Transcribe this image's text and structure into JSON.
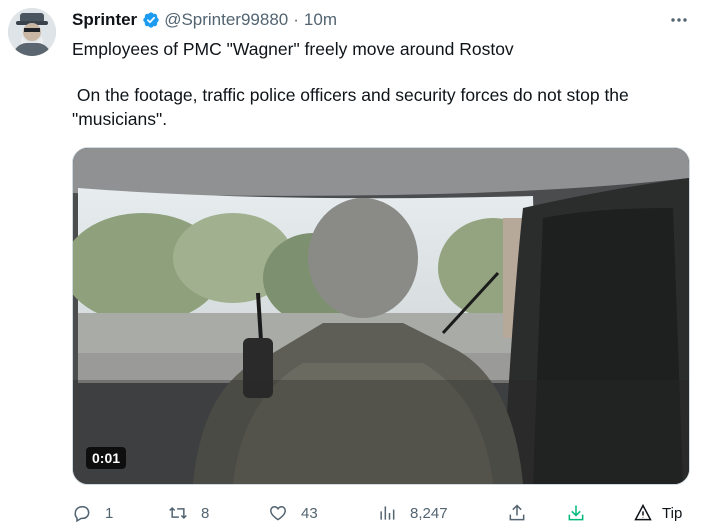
{
  "author": {
    "display_name": "Sprinter",
    "handle": "@Sprinter99880",
    "time": "10m",
    "separator": "·",
    "verified": true
  },
  "tweet": {
    "line1": "Employees of PMC \"Wagner\" freely move around Rostov",
    "line2": " On the footage, traffic police officers and security forces do not stop the \"musicians\"."
  },
  "media": {
    "duration": "0:01"
  },
  "actions": {
    "replies": "1",
    "retweets": "8",
    "likes": "43",
    "views": "8,247",
    "tip_label": "Tip"
  },
  "colors": {
    "verified_blue": "#1d9bf0",
    "download_green": "#00ba7c",
    "muted_text": "#536471"
  },
  "icons": [
    "more-icon",
    "verified-icon",
    "reply-icon",
    "retweet-icon",
    "like-icon",
    "views-icon",
    "share-icon",
    "download-icon",
    "tip-icon"
  ]
}
